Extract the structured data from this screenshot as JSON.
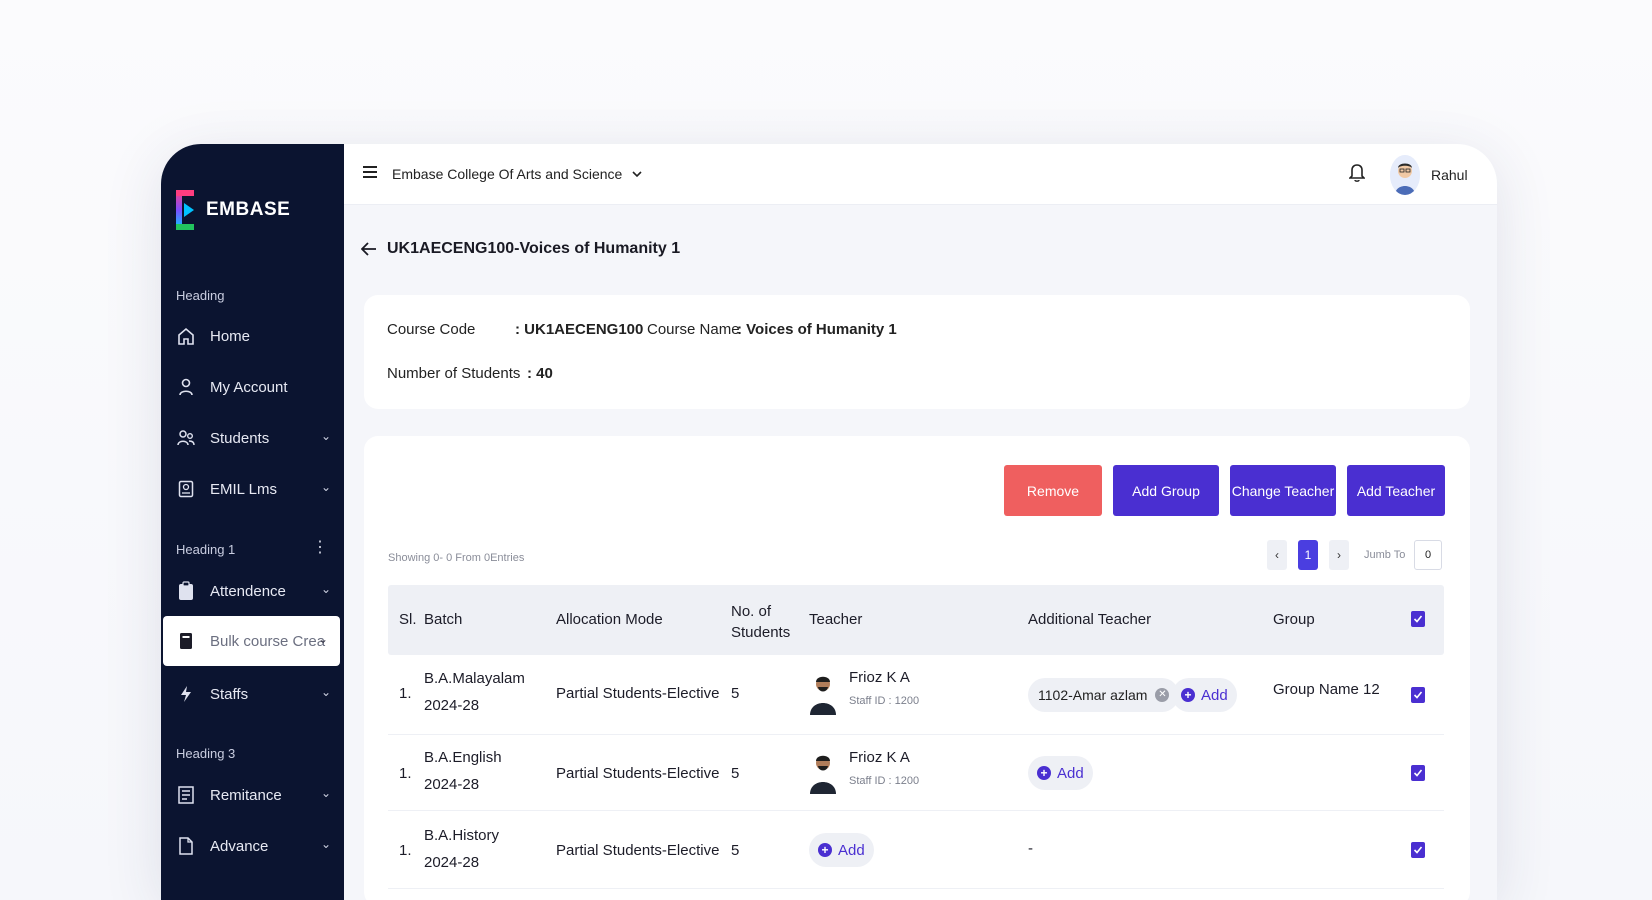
{
  "brand": {
    "name": "EMBASE"
  },
  "sidebar": {
    "headings": [
      "Heading",
      "Heading 1",
      "Heading 3"
    ],
    "items": [
      {
        "label": "Home",
        "icon": "home-icon"
      },
      {
        "label": "My Account",
        "icon": "user-icon"
      },
      {
        "label": "Students",
        "icon": "users-icon"
      },
      {
        "label": "EMIL Lms",
        "icon": "book-icon"
      },
      {
        "label": "Attendence",
        "icon": "clipboard-icon"
      },
      {
        "label": "Bulk course Crea",
        "icon": "file-icon"
      },
      {
        "label": "Staffs",
        "icon": "bolt-icon"
      },
      {
        "label": "Remitance",
        "icon": "receipt-icon"
      },
      {
        "label": "Advance",
        "icon": "document-icon"
      }
    ]
  },
  "topbar": {
    "college": "Embase College Of Arts and Science",
    "user": "Rahul"
  },
  "page": {
    "title": "UK1AECENG100-Voices of Humanity 1"
  },
  "course": {
    "code_label": "Course Code",
    "code_value": ": UK1AECENG100",
    "name_label": "Course Name",
    "name_value": ": Voices of Humanity 1",
    "students_label": "Number of Students",
    "students_value": ": 40"
  },
  "actions": {
    "remove": "Remove",
    "add_group": "Add Group",
    "change_teacher": "Change Teacher",
    "add_teacher": "Add Teacher"
  },
  "table": {
    "showing": "Showing 0- 0 From 0Entries",
    "current_page": "1",
    "jump_label": "Jumb To",
    "jump_value": "0",
    "headers": {
      "sl": "Sl.",
      "batch": "Batch",
      "mode": "Allocation Mode",
      "students": "No. of Students",
      "teacher": "Teacher",
      "additional": "Additional Teacher",
      "group": "Group"
    },
    "add_label": "Add",
    "rows": [
      {
        "sl": "1.",
        "batch1": "B.A.Malayalam",
        "batch2": "2024-28",
        "mode": "Partial Students-Elective",
        "students": "5",
        "teacher": "Frioz K A",
        "staff": "Staff ID : 1200",
        "chip": "1102-Amar azlam",
        "group": "Group Name 12",
        "none": ""
      },
      {
        "sl": "1.",
        "batch1": "B.A.English",
        "batch2": "2024-28",
        "mode": "Partial Students-Elective",
        "students": "5",
        "teacher": "Frioz K A",
        "staff": "Staff ID : 1200"
      },
      {
        "sl": "1.",
        "batch1": "B.A.History",
        "batch2": "2024-28",
        "mode": "Partial Students-Elective",
        "students": "5",
        "additional": "-"
      }
    ]
  }
}
